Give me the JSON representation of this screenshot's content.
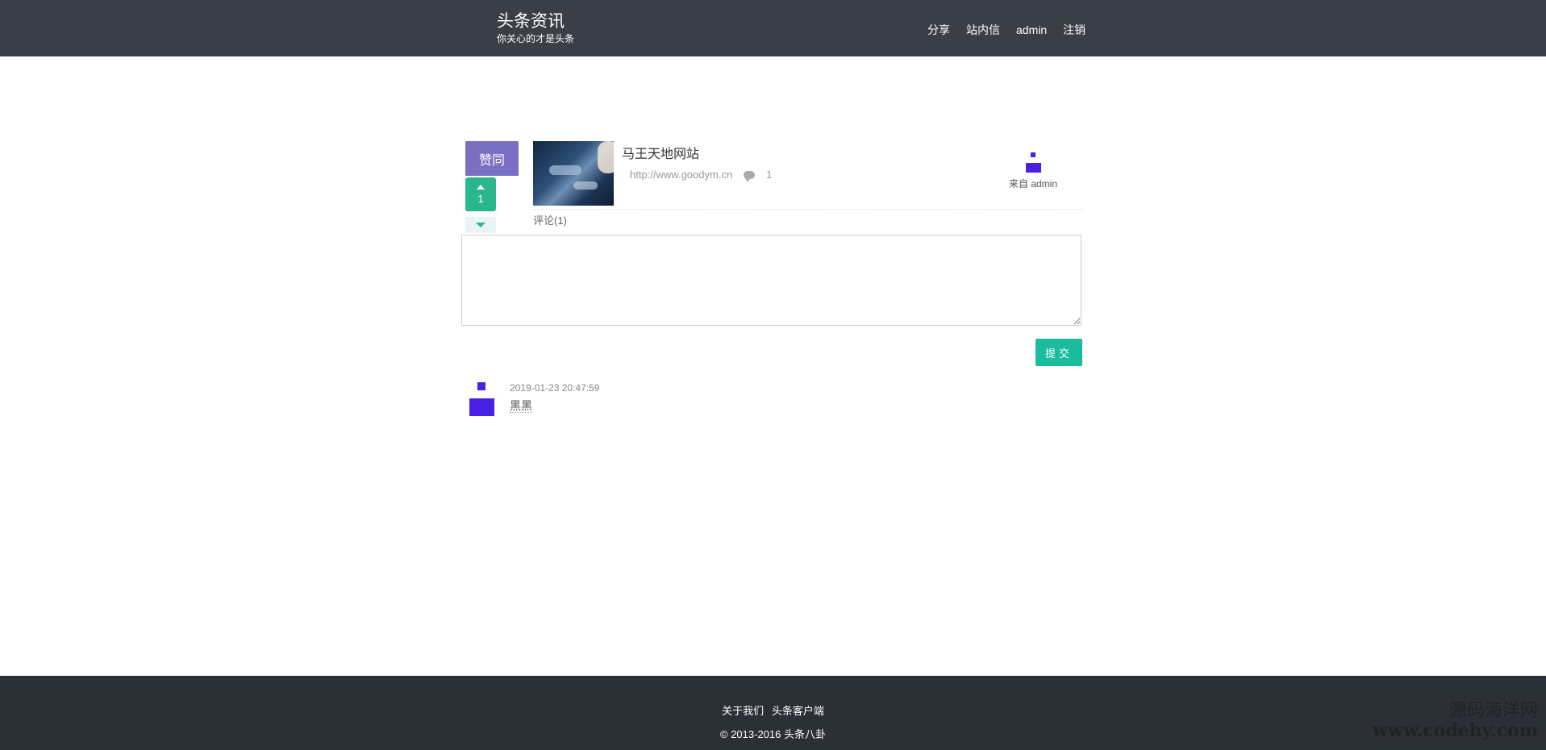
{
  "header": {
    "title": "头条资讯",
    "subtitle": "你关心的才是头条",
    "nav": [
      "分享",
      "站内信",
      "admin",
      "注销"
    ]
  },
  "vote": {
    "like_label": "赞同",
    "count": "1"
  },
  "news": {
    "title": "马王天地网站",
    "link": "http://www.goodym.cn",
    "comment_count": "1",
    "author_prefix": "来自",
    "author": "admin"
  },
  "comments": {
    "label": "评论(1)",
    "textarea_value": "",
    "submit_label": "提交",
    "items": [
      {
        "date": "2019-01-23 20:47:59",
        "text": "黑黑"
      }
    ]
  },
  "footer": {
    "links": [
      "关于我们",
      "头条客户端"
    ],
    "copyright": "© 2013-2016 头条八卦"
  },
  "watermark": {
    "line1": "源码海洋网",
    "line2": "www.codehy.com"
  },
  "colors": {
    "header_bg": "#3a3f47",
    "like_button": "#7b6fc4",
    "vote_up": "#2ab78f",
    "submit": "#1abc9c",
    "avatar": "#4a1fe6",
    "footer_bg": "#2b2f36"
  },
  "icons": {
    "up": "caret-up-icon",
    "down": "caret-down-icon",
    "comment": "comment-bubble-icon"
  }
}
